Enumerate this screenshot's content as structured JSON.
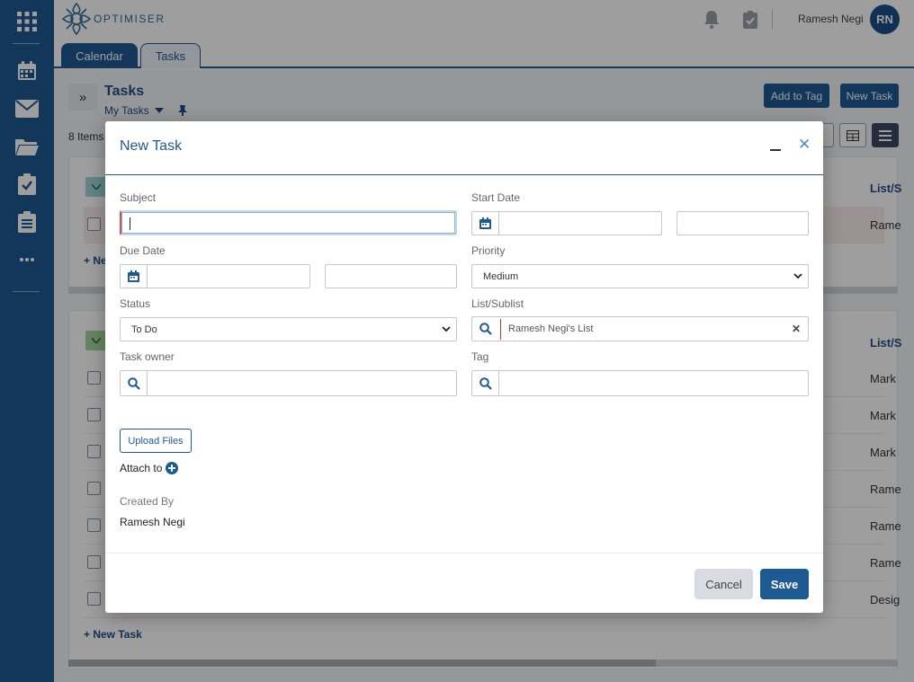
{
  "app": {
    "logo_text": "OPTIMISER",
    "user_name": "Ramesh Negi",
    "user_initials": "RN"
  },
  "tabs": [
    {
      "label": "Calendar",
      "active": true
    },
    {
      "label": "Tasks",
      "active": false
    }
  ],
  "page": {
    "title": "Tasks",
    "view": "My Tasks",
    "items_count": "8 Items",
    "add_to_tag": "Add to Tag",
    "new_task": "New Task",
    "column_list": "List/S",
    "new_task_link": "+ New Task",
    "new_task_link_partial": "+ Ne",
    "group1_rows": [
      {
        "cell": "Rame"
      }
    ],
    "group2_rows": [
      {
        "cell": "Mark"
      },
      {
        "cell": "Mark"
      },
      {
        "cell": "Mark"
      },
      {
        "cell": "Rame"
      },
      {
        "cell": "Rame"
      },
      {
        "cell": "Rame"
      },
      {
        "cell": "Desig"
      }
    ]
  },
  "modal": {
    "title": "New Task",
    "subject_label": "Subject",
    "subject_value": "",
    "start_date_label": "Start Date",
    "due_date_label": "Due Date",
    "priority_label": "Priority",
    "priority_value": "Medium",
    "status_label": "Status",
    "status_value": "To Do",
    "list_label": "List/Sublist",
    "list_value": "Ramesh Negi's List",
    "owner_label": "Task owner",
    "tag_label": "Tag",
    "upload_label": "Upload Files",
    "attach_label": "Attach to",
    "created_by_label": "Created By",
    "created_by_value": "Ramesh Negi",
    "cancel_label": "Cancel",
    "save_label": "Save"
  },
  "colors": {
    "brand": "#1d5a94",
    "accent": "#4a90c8"
  }
}
